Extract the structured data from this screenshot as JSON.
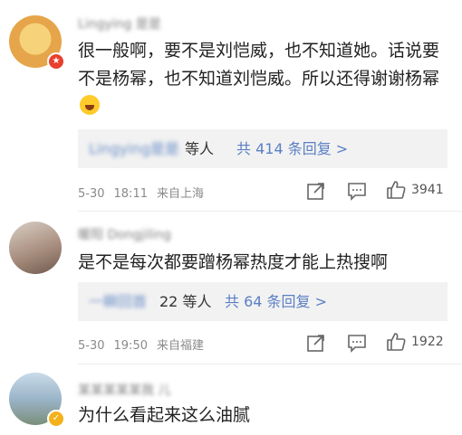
{
  "comments": [
    {
      "username": "Lingying 是是",
      "text": "很一般啊，要不是刘恺威，也不知道她。话说要不是杨幂，也不知道刘恺威。所以还得谢谢杨幂",
      "reply_blur": "Lingying是是",
      "reply_who": "等人",
      "reply_count": "共 414 条回复 >",
      "date": "5-30",
      "time": "18:11",
      "location": "来自上海",
      "likes": "3941"
    },
    {
      "username": "暖阳 Dongjiling",
      "text": "是不是每次都要蹭杨幂热度才能上热搜啊",
      "reply_blur": "一瞬回首",
      "reply_who": "22 等人",
      "reply_count": "共 64 条回复 >",
      "date": "5-30",
      "time": "19:50",
      "location": "来自福建",
      "likes": "1922"
    },
    {
      "username": "某某某某某我 儿",
      "text": "为什么看起来这么油腻"
    }
  ],
  "icons": {
    "share": "share-icon",
    "comment": "comment-icon",
    "like": "thumbs-up-icon"
  },
  "colors": {
    "link": "#5b7fc4",
    "reply_bg": "#f2f2f2",
    "meta": "#8a8a8a"
  }
}
